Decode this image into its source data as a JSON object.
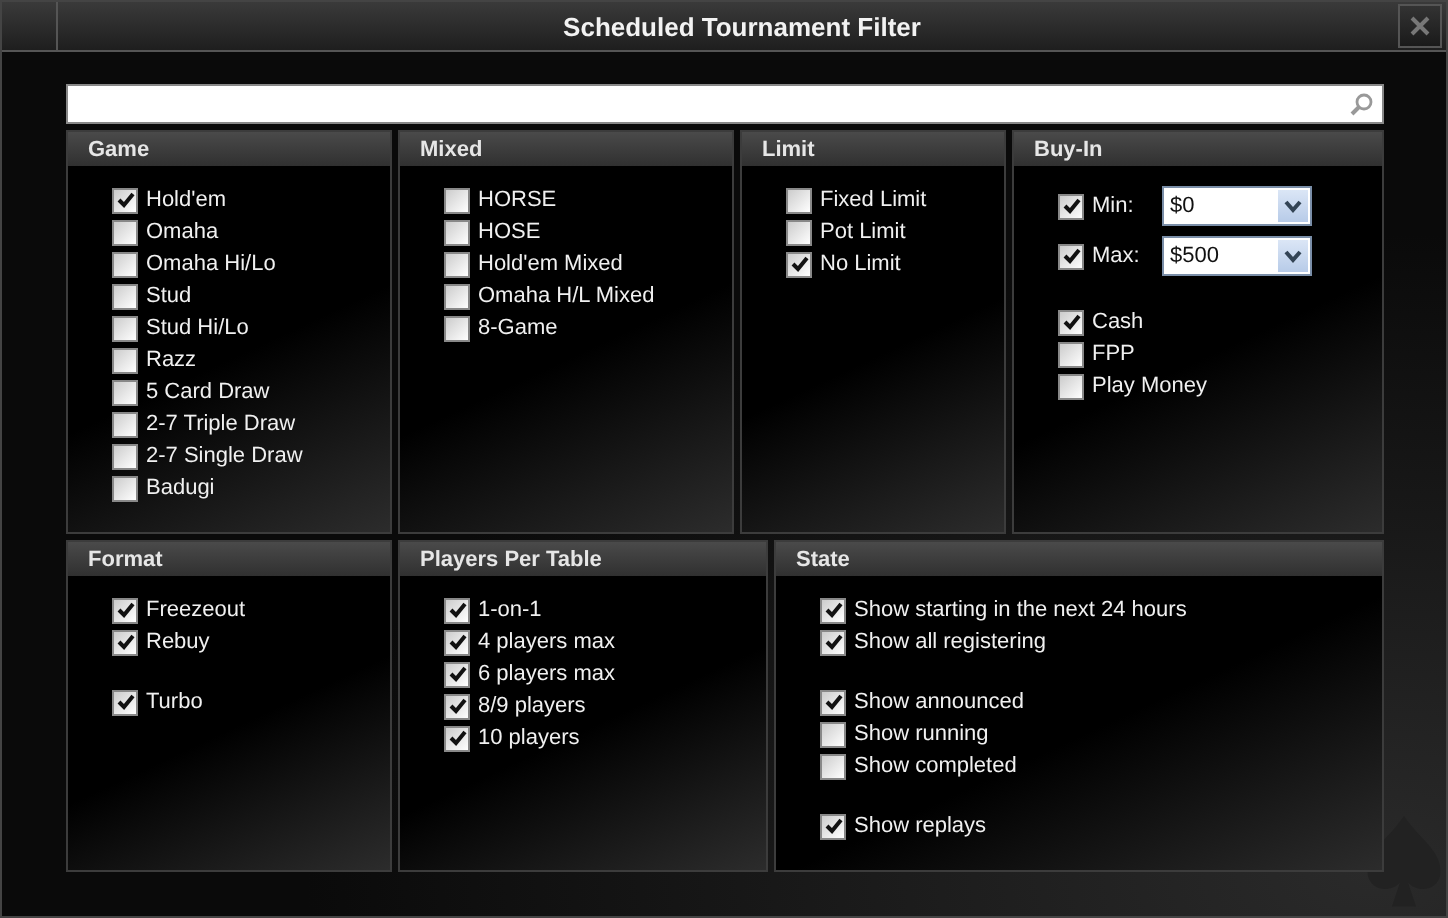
{
  "window": {
    "title": "Scheduled Tournament Filter"
  },
  "top_panels": [
    {
      "title": "Game",
      "kind": "checklist",
      "groups": [
        [
          {
            "label": "Hold'em",
            "checked": true
          },
          {
            "label": "Omaha",
            "checked": false
          },
          {
            "label": "Omaha Hi/Lo",
            "checked": false
          },
          {
            "label": "Stud",
            "checked": false
          },
          {
            "label": "Stud Hi/Lo",
            "checked": false
          },
          {
            "label": "Razz",
            "checked": false
          },
          {
            "label": "5 Card Draw",
            "checked": false
          },
          {
            "label": "2-7 Triple Draw",
            "checked": false
          },
          {
            "label": "2-7 Single Draw",
            "checked": false
          },
          {
            "label": "Badugi",
            "checked": false
          }
        ]
      ]
    },
    {
      "title": "Mixed",
      "kind": "checklist",
      "groups": [
        [
          {
            "label": "HORSE",
            "checked": false
          },
          {
            "label": "HOSE",
            "checked": false
          },
          {
            "label": "Hold'em Mixed",
            "checked": false
          },
          {
            "label": "Omaha H/L Mixed",
            "checked": false
          },
          {
            "label": "8-Game",
            "checked": false
          }
        ]
      ]
    },
    {
      "title": "Limit",
      "kind": "checklist",
      "groups": [
        [
          {
            "label": "Fixed Limit",
            "checked": false
          },
          {
            "label": "Pot Limit",
            "checked": false
          },
          {
            "label": "No Limit",
            "checked": true
          }
        ]
      ]
    },
    {
      "title": "Buy-In",
      "kind": "buyin",
      "limits": [
        {
          "label": "Min:",
          "checked": true,
          "value": "$0"
        },
        {
          "label": "Max:",
          "checked": true,
          "value": "$500"
        }
      ],
      "groups": [
        [
          {
            "label": "Cash",
            "checked": true
          },
          {
            "label": "FPP",
            "checked": false
          },
          {
            "label": "Play Money",
            "checked": false
          }
        ]
      ]
    }
  ],
  "bottom_panels": [
    {
      "title": "Format",
      "kind": "checklist",
      "groups": [
        [
          {
            "label": "Freezeout",
            "checked": true
          },
          {
            "label": "Rebuy",
            "checked": true
          }
        ],
        [
          {
            "label": "Turbo",
            "checked": true
          }
        ]
      ]
    },
    {
      "title": "Players Per Table",
      "kind": "checklist",
      "groups": [
        [
          {
            "label": "1-on-1",
            "checked": true
          },
          {
            "label": "4 players max",
            "checked": true
          },
          {
            "label": "6 players max",
            "checked": true
          },
          {
            "label": "8/9 players",
            "checked": true
          },
          {
            "label": "10 players",
            "checked": true
          }
        ]
      ]
    },
    {
      "title": "State",
      "kind": "checklist",
      "groups": [
        [
          {
            "label": "Show starting in the next 24 hours",
            "checked": true
          },
          {
            "label": "Show all registering",
            "checked": true
          }
        ],
        [
          {
            "label": "Show announced",
            "checked": true
          },
          {
            "label": "Show running",
            "checked": false
          },
          {
            "label": "Show completed",
            "checked": false
          }
        ],
        [
          {
            "label": "Show replays",
            "checked": true
          }
        ]
      ]
    }
  ]
}
